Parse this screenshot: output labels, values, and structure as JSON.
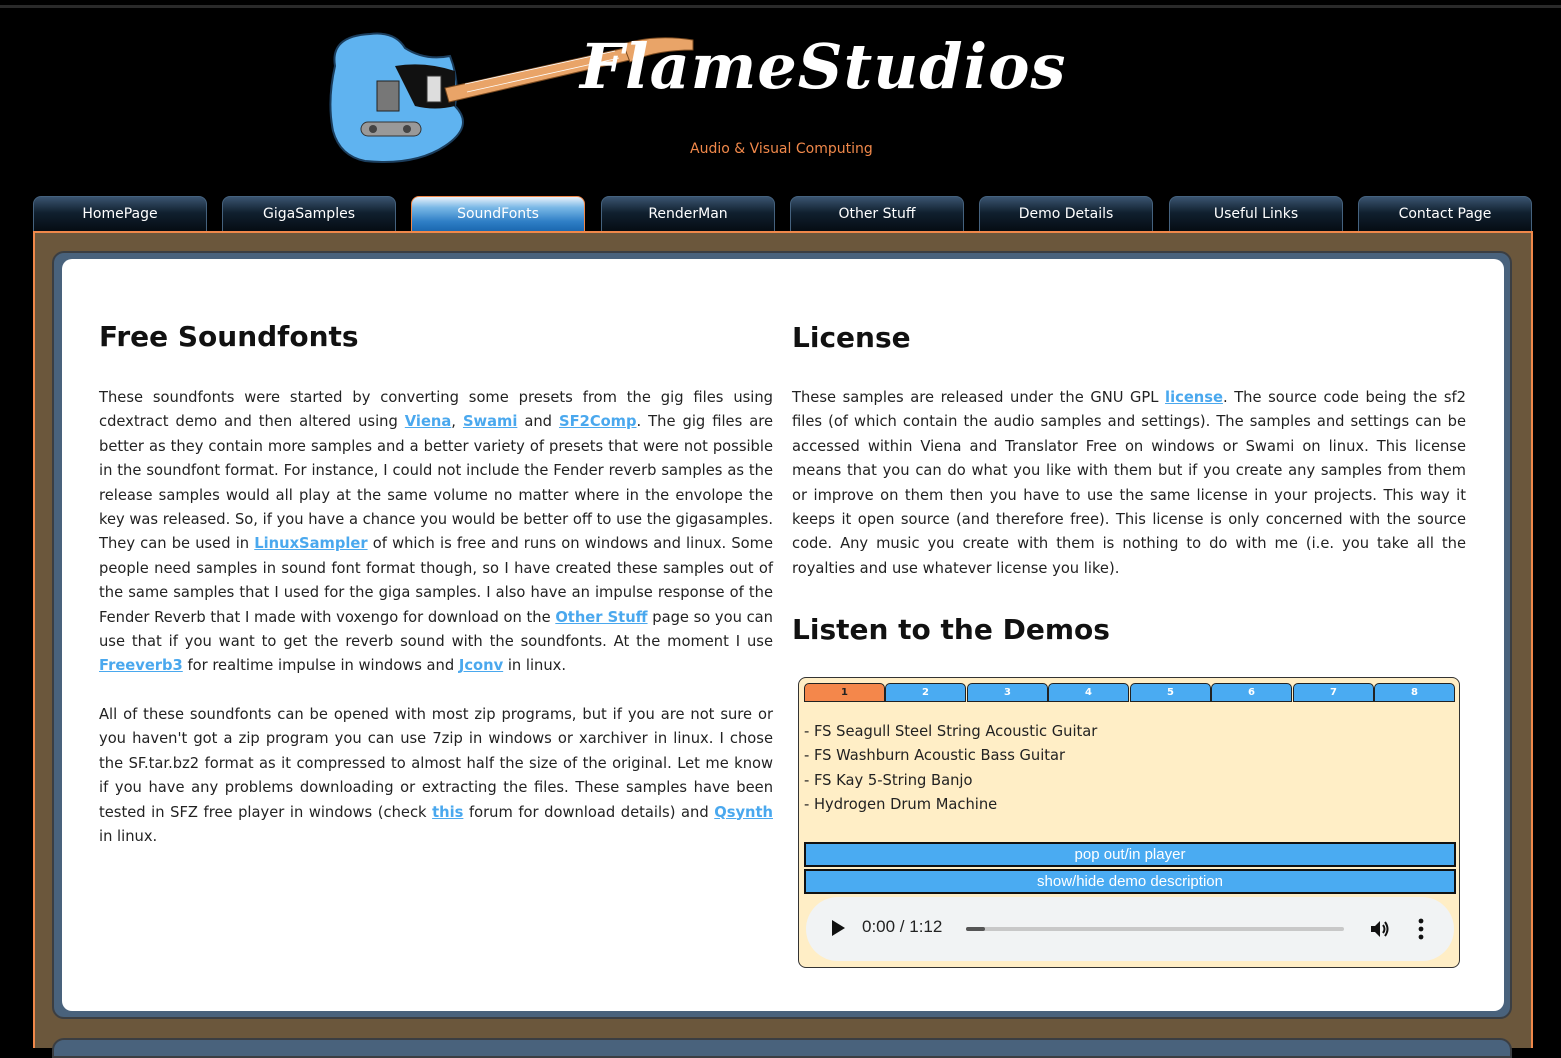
{
  "header": {
    "logo_text": "FlameStudios",
    "tagline": "Audio & Visual Computing"
  },
  "nav": {
    "tabs": [
      {
        "label": "HomePage",
        "active": false
      },
      {
        "label": "GigaSamples",
        "active": false
      },
      {
        "label": "SoundFonts",
        "active": true
      },
      {
        "label": "RenderMan",
        "active": false
      },
      {
        "label": "Other Stuff",
        "active": false
      },
      {
        "label": "Demo Details",
        "active": false
      },
      {
        "label": "Useful Links",
        "active": false
      },
      {
        "label": "Contact Page",
        "active": false
      }
    ]
  },
  "left": {
    "title": "Free Soundfonts",
    "p1": {
      "t1": "These soundfonts were started by converting some presets from the gig files using cdextract demo and then altered using ",
      "link_viena": "Viena",
      "t2": ", ",
      "link_swami": "Swami",
      "t3": " and ",
      "link_sf2comp": "SF2Comp",
      "t4": ". The gig files are better as they contain more samples and a better variety of presets that were not possible in the soundfont format. For instance, I could not include the Fender reverb samples as the release samples would all play at the same volume no matter where in the envolope the key was released. So, if you have a chance you would be better off to use the gigasamples. They can be used in ",
      "link_linuxsampler": "LinuxSampler",
      "t5": " of which is free and runs on windows and linux. Some people need samples in sound font format though, so I have created these samples out of the same samples that I used for the giga samples. I also have an impulse response of the Fender Reverb that I made with voxengo for download on the ",
      "link_otherstuff": "Other Stuff",
      "t6": " page so you can use that if you want to get the reverb sound with the soundfonts. At the moment I use ",
      "link_freeverb3": "Freeverb3",
      "t7": " for realtime impulse in windows and ",
      "link_jconv": "Jconv",
      "t8": " in linux."
    },
    "p2": {
      "t1": "All of these soundfonts can be opened with most zip programs, but if you are not sure or you haven't got a zip program you can use 7zip in windows or xarchiver in linux. I chose the SF.tar.bz2 format as it compressed to almost half the size of the original. Let me know if you have any problems downloading or extracting the files. These samples have been tested in SFZ free player in windows (check ",
      "link_this": "this",
      "t2": " forum for download details) and ",
      "link_qsynth": "Qsynth",
      "t3": " in linux."
    }
  },
  "right": {
    "license_title": "License",
    "license": {
      "t1": "These samples are released under the GNU GPL ",
      "link_license": "license",
      "t2": ". The source code being the sf2 files (of which contain the audio samples and settings). The samples and settings can be accessed within Viena and Translator Free on windows or Swami on linux. This license means that you can do what you like with them but if you create any samples from them or improve on them then you have to use the same license in your projects. This way it keeps it open source (and therefore free). This license is only concerned with the source code. Any music you create with them is nothing to do with me (i.e. you take all the royalties and use whatever license you like)."
    },
    "demos_title": "Listen to the Demos"
  },
  "player": {
    "tabs": [
      "1",
      "2",
      "3",
      "4",
      "5",
      "6",
      "7",
      "8"
    ],
    "active_tab": "1",
    "items": [
      "- FS Seagull Steel String Acoustic Guitar",
      "- FS Washburn Acoustic Bass Guitar",
      "- FS Kay 5-String Banjo",
      "- Hydrogen Drum Machine"
    ],
    "popout_label": "pop out/in player",
    "showhide_label": "show/hide demo description",
    "time": "0:00 / 1:12",
    "progress": 0.05
  },
  "colors": {
    "accent_orange": "#f0884a",
    "link_blue": "#4aa8ee",
    "frame_brown": "#6b573c",
    "player_bg": "#ffeec6"
  }
}
